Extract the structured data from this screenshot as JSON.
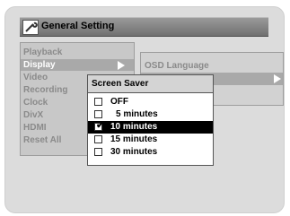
{
  "header": {
    "title": "General Setting",
    "icon": "wrench-icon"
  },
  "left_menu": {
    "items": [
      {
        "label": "Playback"
      },
      {
        "label": "Display"
      },
      {
        "label": "Video"
      },
      {
        "label": "Recording"
      },
      {
        "label": "Clock"
      },
      {
        "label": "DivX"
      },
      {
        "label": "HDMI"
      },
      {
        "label": "Reset All"
      }
    ],
    "selected": "Display"
  },
  "right_menu": {
    "items": [
      {
        "label": "OSD Language"
      }
    ]
  },
  "popup": {
    "title": "Screen Saver",
    "options": [
      {
        "label": "OFF",
        "checked": false
      },
      {
        "label": "5 minutes",
        "checked": false
      },
      {
        "label": "10  minutes",
        "checked": true
      },
      {
        "label": "15  minutes",
        "checked": false
      },
      {
        "label": "30  minutes",
        "checked": false
      }
    ]
  },
  "colors": {
    "highlight": "#000000",
    "header": "#808080",
    "background": "#dcdcdc"
  }
}
